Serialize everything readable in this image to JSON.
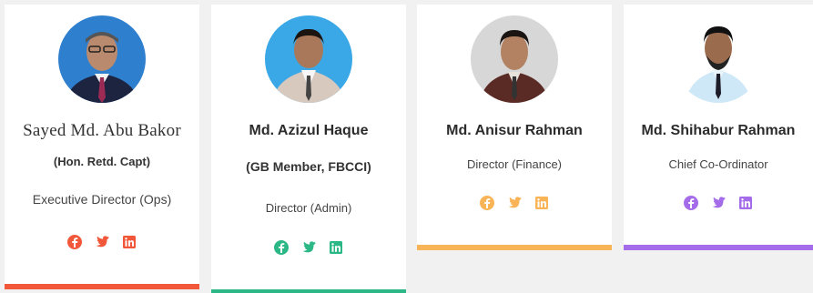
{
  "members": [
    {
      "name": "Sayed Md. Abu Bakor",
      "subtitle": "(Hon. Retd. Capt)",
      "role": "Executive Director (Ops)",
      "accent": "#f1583a",
      "icons": [
        "facebook-icon",
        "twitter-icon",
        "linkedin-icon"
      ]
    },
    {
      "name": "Md. Azizul Haque",
      "subtitle": "(GB Member, FBCCI)",
      "role": "Director (Admin)",
      "accent": "#2cb886",
      "icons": [
        "facebook-icon",
        "twitter-icon",
        "linkedin-icon"
      ]
    },
    {
      "name": "Md. Anisur Rahman",
      "role": "Director (Finance)",
      "accent": "#f8b457",
      "icons": [
        "facebook-icon",
        "twitter-icon",
        "linkedin-icon"
      ]
    },
    {
      "name": "Md. Shihabur Rahman",
      "role": "Chief Co-Ordinator",
      "accent": "#a56cea",
      "icons": [
        "facebook-icon",
        "twitter-icon",
        "linkedin-icon"
      ]
    }
  ]
}
